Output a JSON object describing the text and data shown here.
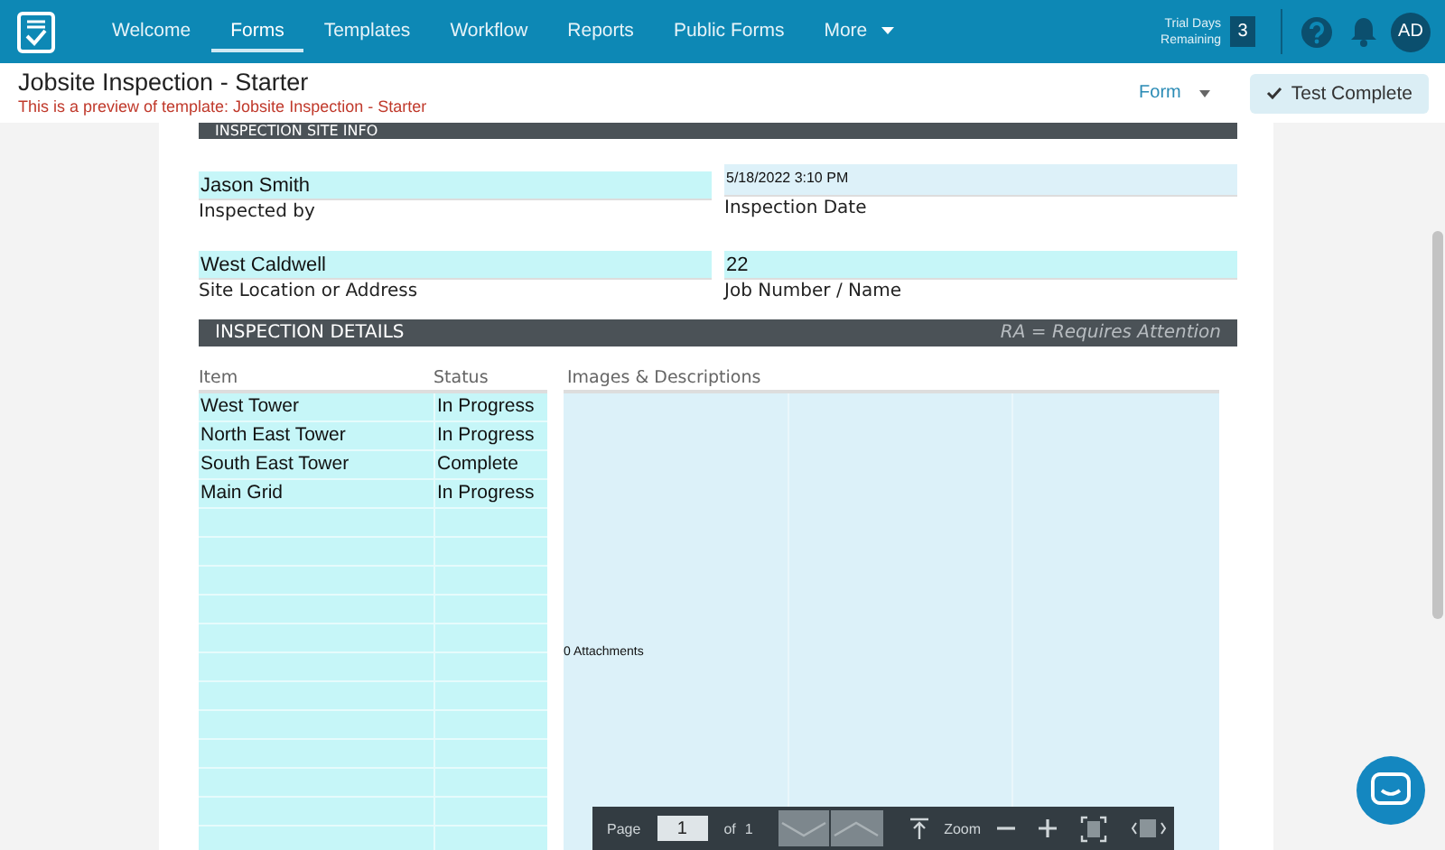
{
  "nav": {
    "items": [
      {
        "label": "Welcome",
        "selected": false
      },
      {
        "label": "Forms",
        "selected": true
      },
      {
        "label": "Templates",
        "selected": false
      },
      {
        "label": "Workflow",
        "selected": false
      },
      {
        "label": "Reports",
        "selected": false
      },
      {
        "label": "Public Forms",
        "selected": false
      },
      {
        "label": "More",
        "selected": false,
        "kind": "menu"
      }
    ],
    "trial": {
      "line_1": "Trial Days",
      "line_2": "Remaining",
      "count": "3"
    },
    "avatar": "AD"
  },
  "header": {
    "title": "Jobsite Inspection - Starter",
    "subtitle": "This is a preview of template: Jobsite Inspection - Starter",
    "menu": "Form",
    "button": "Test Complete"
  },
  "form": {
    "section_1": "INSPECTION SITE INFO",
    "fields": [
      {
        "value": "Jason Smith",
        "label": "Inspected by",
        "kind": "text"
      },
      {
        "value": "5/18/2022 3:10 PM",
        "label": "Inspection Date",
        "kind": "date"
      },
      {
        "value": "West Caldwell",
        "label": "Site Location or Address",
        "kind": "text"
      },
      {
        "value": "22",
        "label": "Job Number / Name",
        "kind": "text"
      }
    ],
    "section_2": {
      "title": "INSPECTION DETAILS",
      "note": "RA = Requires Attention"
    },
    "table": {
      "columns": [
        "Item",
        "Status",
        "Images & Descriptions"
      ],
      "rows": [
        {
          "item": "West Tower",
          "status": "In Progress"
        },
        {
          "item": "North East Tower",
          "status": "In Progress"
        },
        {
          "item": "South East Tower",
          "status": "Complete"
        },
        {
          "item": "Main Grid",
          "status": "In Progress"
        }
      ],
      "attachments": "0 Attachments"
    }
  },
  "toolbar": {
    "page_label": "Page",
    "page": "1",
    "of_label": "of",
    "total": "1",
    "zoom_label": "Zoom"
  }
}
